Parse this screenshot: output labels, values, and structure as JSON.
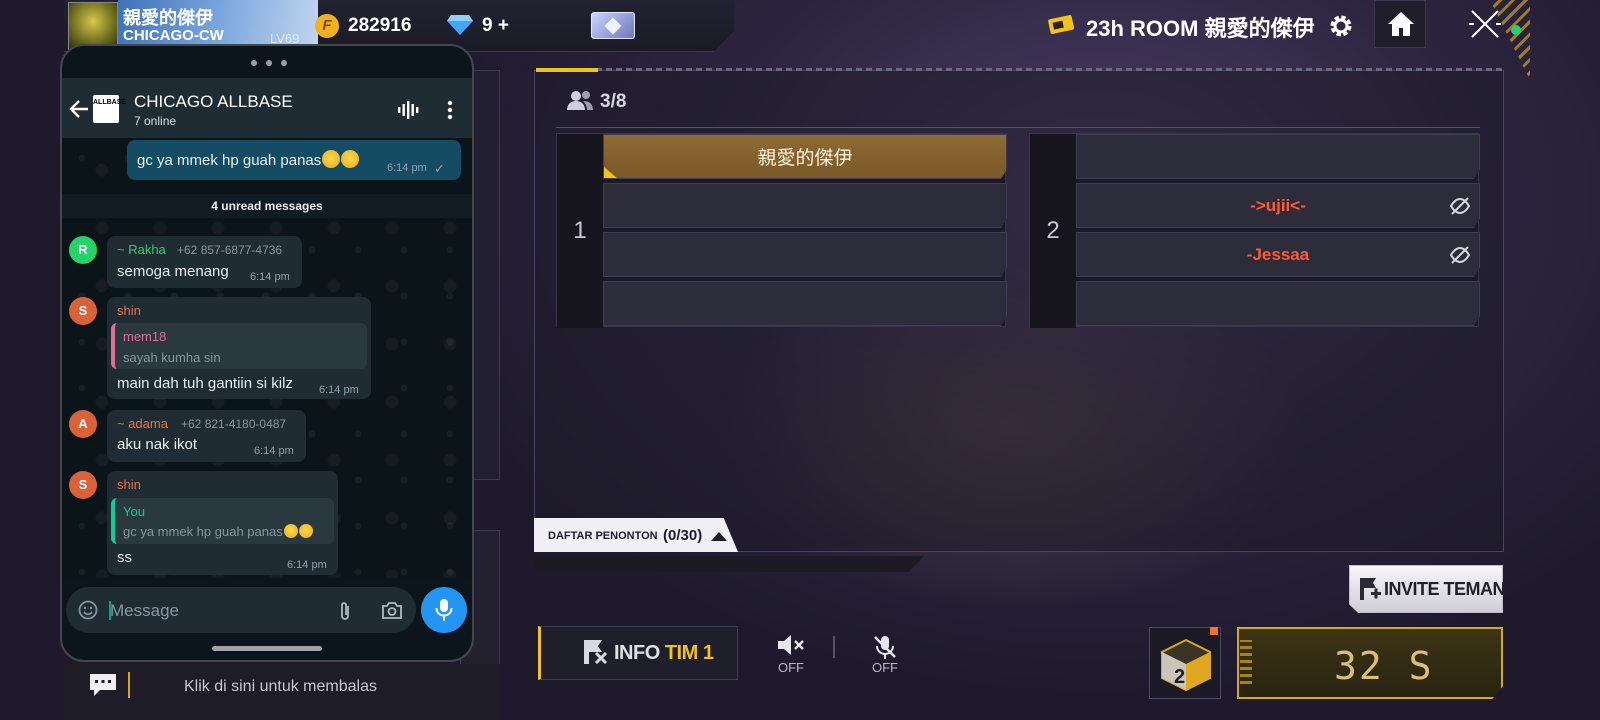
{
  "profile": {
    "name": "親愛的傑伊",
    "clan": "CHICAGO-CW",
    "level": "LV69"
  },
  "currency": {
    "coins": "282916",
    "coin_icon": "coin-icon",
    "diamonds": "9 +",
    "diamond_icon": "diamond-icon"
  },
  "room": {
    "title": "23h ROOM 親愛的傑伊",
    "players_count": "3/8"
  },
  "teams": [
    {
      "number": "1",
      "slots": [
        "親愛的傑伊",
        "",
        "",
        ""
      ]
    },
    {
      "number": "2",
      "slots": [
        "",
        "->ujii<-",
        "-Jessaa",
        ""
      ]
    }
  ],
  "spectators": {
    "label": "DAFTAR PENONTON",
    "count": "(0/30)"
  },
  "invite": {
    "label": "INVITE TEMAN"
  },
  "controls": {
    "info_label": "INFO",
    "info_team": "TIM 1",
    "speaker_state": "OFF",
    "mic_state": "OFF"
  },
  "timer": {
    "value": "32 S"
  },
  "reply_bar": {
    "label": "Klik di sini untuk membalas"
  },
  "chat": {
    "group_name": "CHICAGO ALLBASE",
    "online": "7 online",
    "group_avatar_text": "ALLBASE",
    "unread": "4 unread messages",
    "input_placeholder": "Message",
    "messages": [
      {
        "text": "gc ya mmek hp guah panas",
        "time": "6:14 pm",
        "status": "✓"
      },
      {
        "avatar": "R",
        "sender": "~ Rakha",
        "phone": "+62 857-6877-4736",
        "text": "semoga menang",
        "time": "6:14 pm"
      },
      {
        "avatar": "S",
        "sender": "shin",
        "quote_author": "mem18",
        "quote_text": "sayah kumha sin",
        "text": "main dah tuh gantiin si kilz",
        "time": "6:14 pm"
      },
      {
        "avatar": "A",
        "sender": "~ adama",
        "phone": "+62 821-4180-0487",
        "text": "aku nak ikot",
        "time": "6:14 pm"
      },
      {
        "avatar": "S",
        "sender": "shin",
        "quote_author": "You",
        "quote_text": "gc ya mmek hp guah panas",
        "text": "ss",
        "time": "6:14 pm"
      }
    ]
  },
  "colors": {
    "accent_gold": "#f2c21d",
    "enemy_name": "#ff5a33",
    "chat_send": "#2196f3",
    "online_dot": "#2ecc71"
  }
}
